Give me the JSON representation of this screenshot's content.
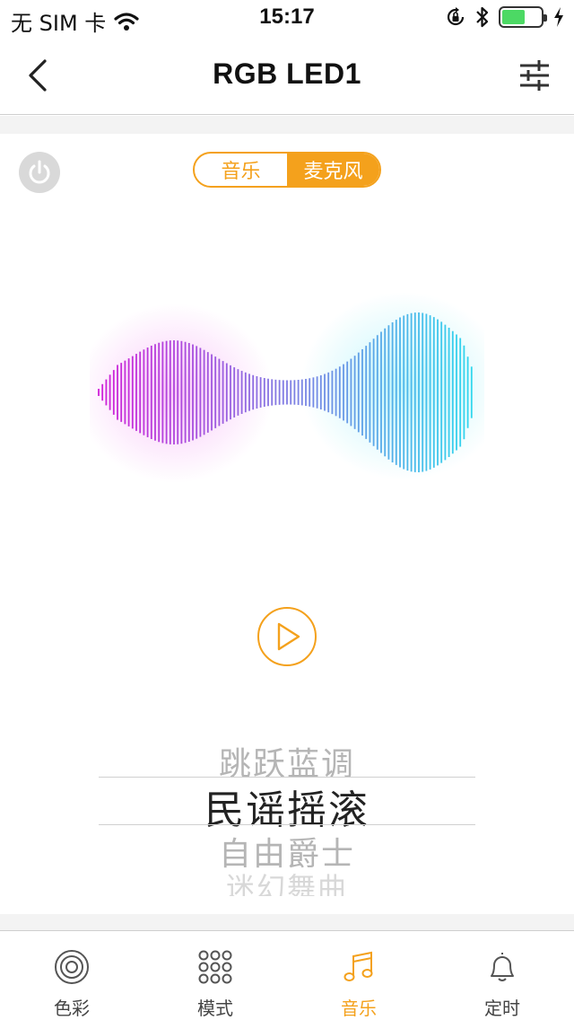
{
  "status_bar": {
    "carrier": "无 SIM 卡",
    "time": "15:17",
    "battery_level": 0.6
  },
  "nav": {
    "title": "RGB LED1",
    "back_icon": "chevron-left-icon",
    "settings_icon": "sliders-icon"
  },
  "controls": {
    "power_icon": "power-icon",
    "segments": [
      {
        "label": "音乐",
        "active": false
      },
      {
        "label": "麦克风",
        "active": true
      }
    ],
    "play_icon": "play-icon"
  },
  "colors": {
    "accent": "#f4a11c",
    "wave_left": "#d020d8",
    "wave_right": "#30d8ee"
  },
  "picker": {
    "items": [
      "跳跃蓝调",
      "民谣摇滚",
      "自由爵士",
      "迷幻舞曲"
    ],
    "selected_index": 1
  },
  "tabbar": {
    "tabs": [
      {
        "label": "色彩",
        "icon": "color-rings-icon",
        "active": false
      },
      {
        "label": "模式",
        "icon": "grid-dots-icon",
        "active": false
      },
      {
        "label": "音乐",
        "icon": "music-note-icon",
        "active": true
      },
      {
        "label": "定时",
        "icon": "bell-icon",
        "active": false
      }
    ]
  }
}
